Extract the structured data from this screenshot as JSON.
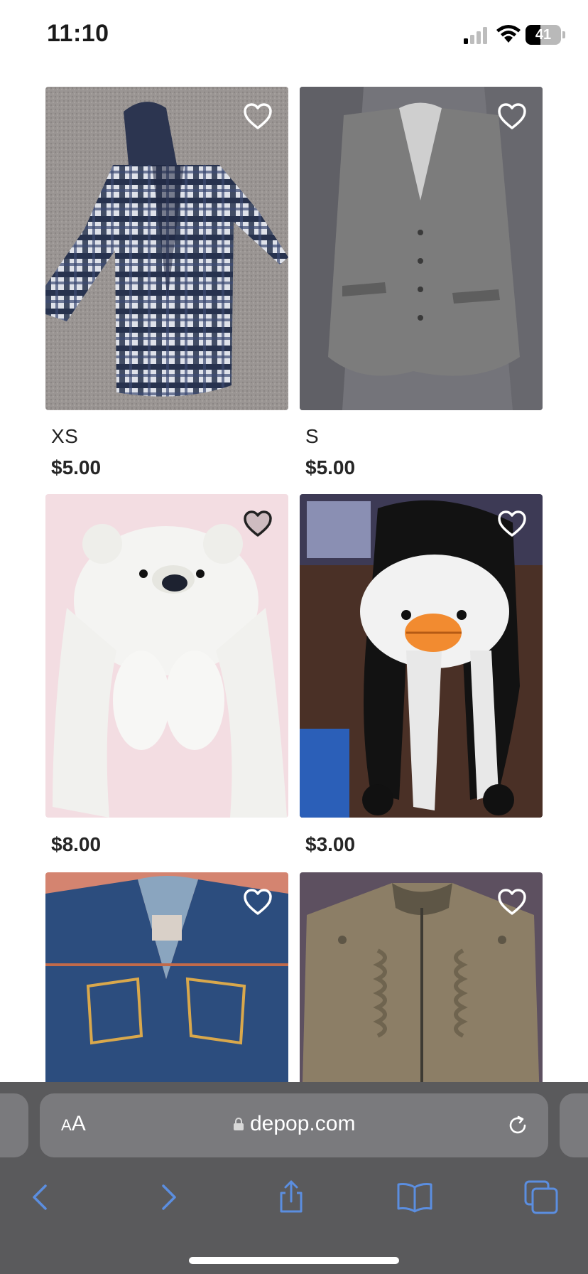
{
  "status_bar": {
    "time": "11:10",
    "battery": "41",
    "battery_level": 0.41
  },
  "listings": [
    {
      "size": "XS",
      "price": "$5.00",
      "image": "plaid-hooded-shirt",
      "favorite_icon": "heart-outline-icon"
    },
    {
      "size": "S",
      "price": "$5.00",
      "image": "gray-tweed-vest",
      "favorite_icon": "heart-outline-icon"
    },
    {
      "size": "",
      "price": "$8.00",
      "image": "white-polar-bear-hat",
      "favorite_icon": "heart-outline-icon"
    },
    {
      "size": "",
      "price": "$3.00",
      "image": "penguin-animal-hat",
      "favorite_icon": "heart-outline-icon"
    },
    {
      "size": "",
      "price": "",
      "image": "denim-vest",
      "favorite_icon": "heart-outline-icon"
    },
    {
      "size": "",
      "price": "",
      "image": "olive-ruffle-jacket",
      "favorite_icon": "heart-outline-icon"
    }
  ],
  "browser": {
    "text_size_label_small": "A",
    "text_size_label_big": "A",
    "url": "depop.com",
    "icons": [
      "back-icon",
      "forward-icon",
      "share-icon",
      "bookmarks-icon",
      "tabs-icon",
      "reload-icon",
      "lock-icon"
    ]
  },
  "colors": {
    "toolbar_bg": "#5a5a5c",
    "url_bar_bg": "#7a7a7d",
    "toolbar_icon": "#5b8ee0"
  }
}
